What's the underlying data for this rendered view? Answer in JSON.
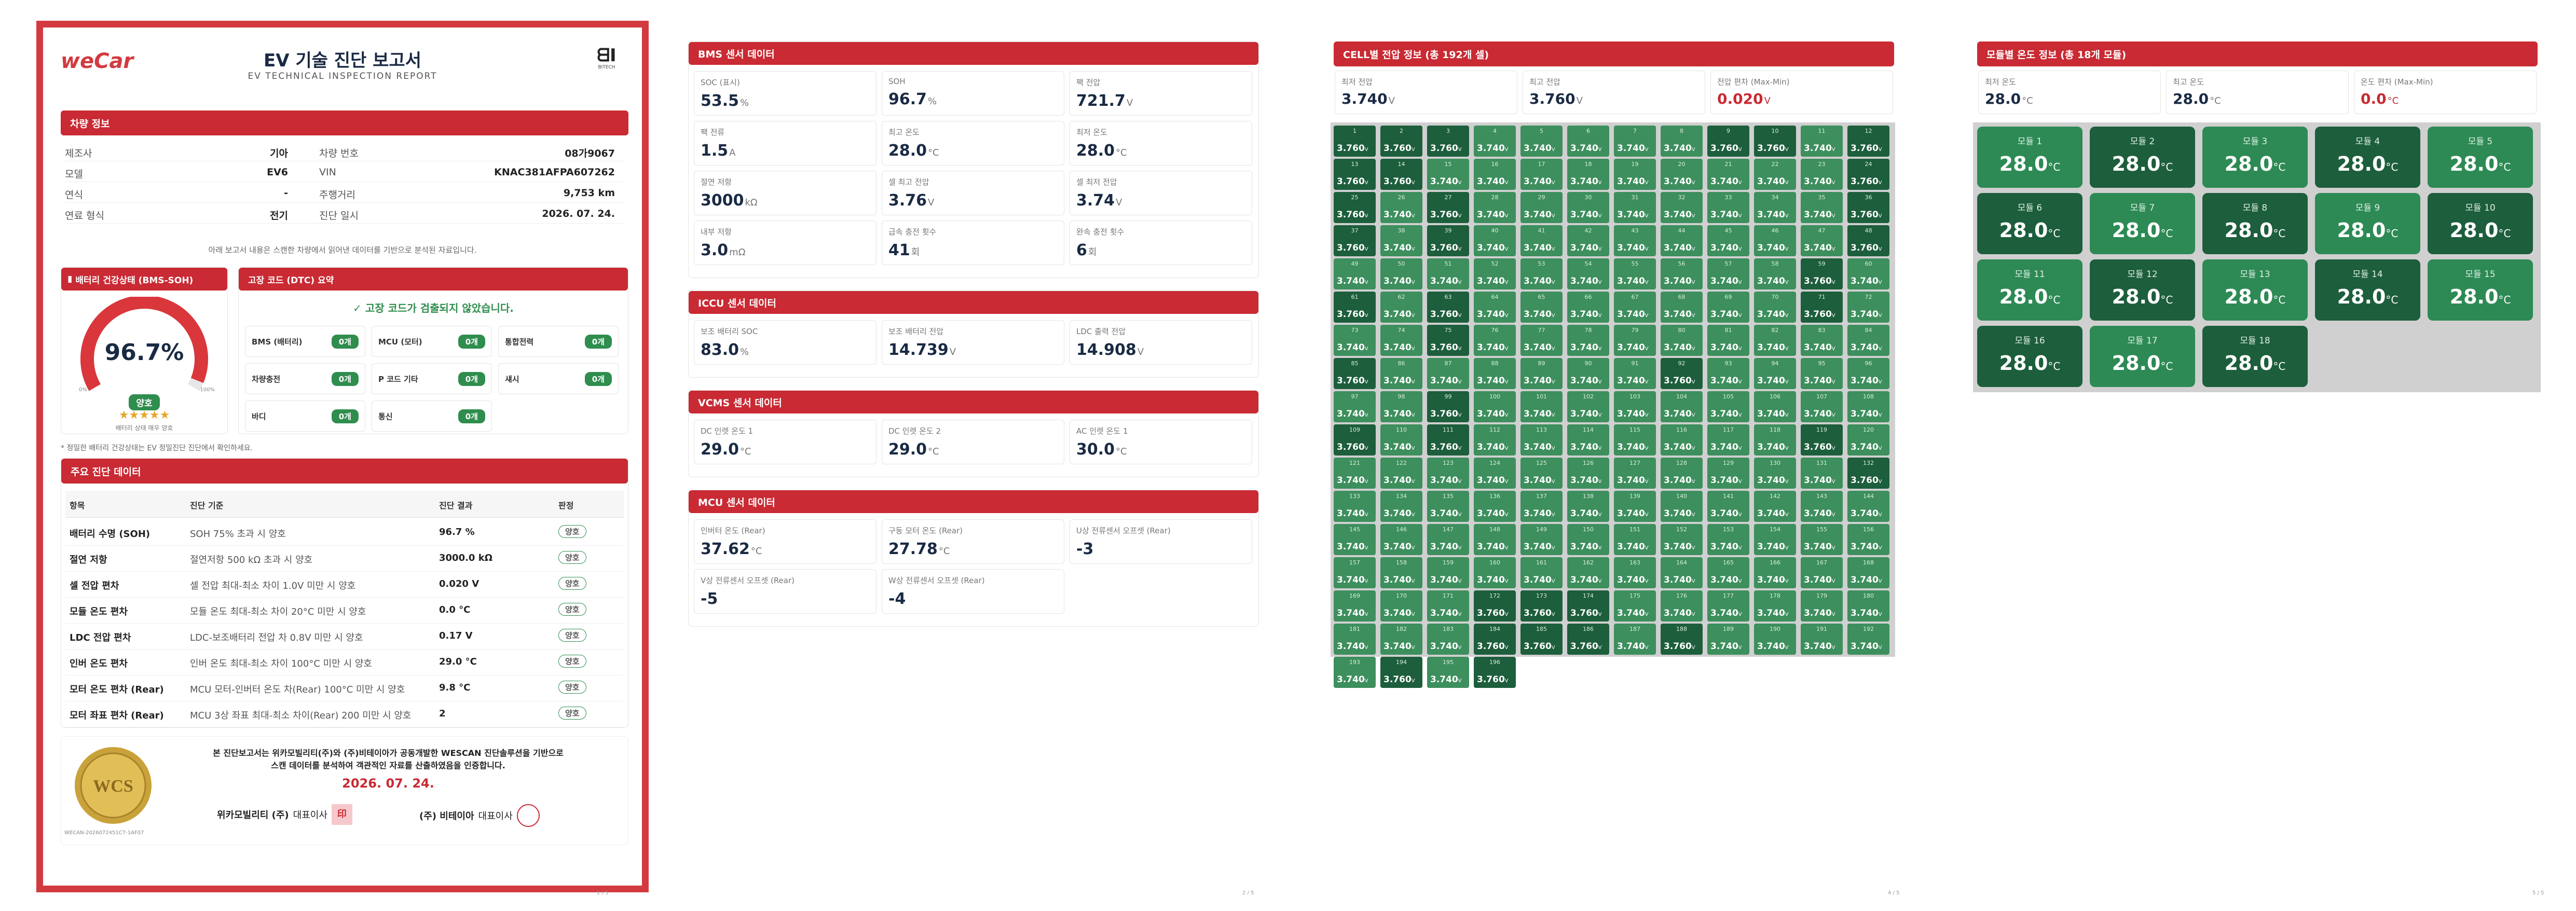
{
  "page1": {
    "logo": "weCar",
    "title": "EV 기술 진단 보고서",
    "subtitle": "EV TECHNICAL INSPECTION REPORT",
    "brand": "BITECH",
    "vehicle_header": "차량 정보",
    "vehicle": [
      [
        "제조사",
        "기아",
        "차량 번호",
        "08가9067"
      ],
      [
        "모델",
        "EV6",
        "VIN",
        "KNAC381AFPA607262"
      ],
      [
        "연식",
        "-",
        "주행거리",
        "9,753 km"
      ],
      [
        "연료 형식",
        "전기",
        "진단 일시",
        "2026. 07. 24."
      ]
    ],
    "note": "아래 보고서 내용은 스캔한 차량에서 읽어낸 데이터를 기반으로 분석된 자료입니다.",
    "soh_header": "배터리 건강상태 (BMS-SOH)",
    "soh_value": "96.7%",
    "soh_fraction": 0.967,
    "gauge_min": "0%",
    "gauge_max": "100%",
    "soh_badge": "양호",
    "stars": "★★★★★",
    "soh_caption": "배터리 상태 매우 양호",
    "dtc_header": "고장 코드 (DTC) 요약",
    "dtc_ok": "✓ 고장 코드가 검출되지 않았습니다.",
    "dtc": [
      [
        "BMS (배터리)",
        "0개"
      ],
      [
        "MCU (모터)",
        "0개"
      ],
      [
        "통합전력",
        "0개"
      ],
      [
        "차량충전",
        "0개"
      ],
      [
        "P 코드 기타",
        "0개"
      ],
      [
        "섀시",
        "0개"
      ],
      [
        "바디",
        "0개"
      ],
      [
        "통신",
        "0개"
      ]
    ],
    "footnote": "* 정밀한 배터리 건강상태는 EV 정밀진단 진단에서 확인하세요.",
    "main_header": "주요 진단 데이터",
    "cols": [
      "항목",
      "진단 기준",
      "진단 결과",
      "판정"
    ],
    "rows": [
      [
        "배터리 수명 (SOH)",
        "SOH 75% 초과 시 양호",
        "96.7 %",
        "양호"
      ],
      [
        "절연 저항",
        "절연저항 500 kΩ 초과 시 양호",
        "3000.0 kΩ",
        "양호"
      ],
      [
        "셀 전압 편차",
        "셀 전압 최대-최소 차이 1.0V 미만 시 양호",
        "0.020 V",
        "양호"
      ],
      [
        "모듈 온도 편차",
        "모듈 온도 최대-최소 차이 20°C 미만 시 양호",
        "0.0 °C",
        "양호"
      ],
      [
        "LDC 전압 편차",
        "LDC-보조배터리 전압 차 0.8V 미만 시 양호",
        "0.17 V",
        "양호"
      ],
      [
        "인버 온도 편차",
        "인버 온도 최대-최소 차이 100°C 미만 시 양호",
        "29.0 °C",
        "양호"
      ],
      [
        "모터 온도 편차 (Rear)",
        "MCU 모터-인버터 온도 차(Rear) 100°C 미만 시 양호",
        "9.8 °C",
        "양호"
      ],
      [
        "모터 좌표 편차 (Rear)",
        "MCU 3상 좌표 최대-최소 차이(Rear) 200 미만 시 양호",
        "2",
        "양호"
      ]
    ],
    "cert1": "본 진단보고서는 위카모빌리티(주)와 (주)비테이아가 공동개발한 WESCAN 진단솔루션을 기반으로",
    "cert2": "스캔 데이터를 분석하여 객관적인 자료를 산출하였음을 인증합니다.",
    "cert_date": "2026. 07. 24.",
    "seal_text": "WCS",
    "seal_id": "WECAN-2026072451C7-1AF07",
    "sign1_org": "위카모빌리티 (주)",
    "sign1_role": "대표이사",
    "sign1_stamp": "印",
    "sign2_org": "(주) 비테이아",
    "sign2_role": "대표이사",
    "page_no": "1 / 5"
  },
  "page2": {
    "page_no": "2 / 5",
    "sections": [
      {
        "title": "BMS 센서 데이터",
        "items": [
          [
            "SOC (표시)",
            "53.5",
            "%"
          ],
          [
            "SOH",
            "96.7",
            "%"
          ],
          [
            "팩 전압",
            "721.7",
            "V"
          ],
          [
            "팩 전류",
            "1.5",
            "A"
          ],
          [
            "최고 온도",
            "28.0",
            "°C"
          ],
          [
            "최저 온도",
            "28.0",
            "°C"
          ],
          [
            "절연 저항",
            "3000",
            "kΩ"
          ],
          [
            "셀 최고 전압",
            "3.76",
            "V"
          ],
          [
            "셀 최저 전압",
            "3.74",
            "V"
          ],
          [
            "내부 저항",
            "3.0",
            "mΩ"
          ],
          [
            "급속 충전 횟수",
            "41",
            "회"
          ],
          [
            "완속 충전 횟수",
            "6",
            "회"
          ]
        ]
      },
      {
        "title": "ICCU 센서 데이터",
        "items": [
          [
            "보조 배터리 SOC",
            "83.0",
            "%"
          ],
          [
            "보조 배터리 전압",
            "14.739",
            "V"
          ],
          [
            "LDC 출력 전압",
            "14.908",
            "V"
          ]
        ]
      },
      {
        "title": "VCMS 센서 데이터",
        "items": [
          [
            "DC 인렛 온도 1",
            "29.0",
            "°C"
          ],
          [
            "DC 인렛 온도 2",
            "29.0",
            "°C"
          ],
          [
            "AC 인렛 온도 1",
            "30.0",
            "°C"
          ]
        ]
      },
      {
        "title": "MCU 센서 데이터",
        "items": [
          [
            "인버터 온도 (Rear)",
            "37.62",
            "°C"
          ],
          [
            "구동 모터 온도 (Rear)",
            "27.78",
            "°C"
          ],
          [
            "U상 전류센서 오프셋 (Rear)",
            "-3",
            ""
          ],
          [
            "V상 전류센서 오프셋 (Rear)",
            "-5",
            ""
          ],
          [
            "W상 전류센서 오프셋 (Rear)",
            "-4",
            ""
          ]
        ]
      }
    ]
  },
  "page3": {
    "page_no": "4 / 5",
    "title": "CELL별 전압 정보 (총 192개 셀)",
    "stats": [
      [
        "최저 전압",
        "3.740",
        "V"
      ],
      [
        "최고 전압",
        "3.760",
        "V"
      ],
      [
        "전압 편차 (Max-Min)",
        "0.020",
        "V"
      ]
    ],
    "unit": "V",
    "cells": [
      "3.760",
      "3.760",
      "3.760",
      "3.740",
      "3.740",
      "3.740",
      "3.740",
      "3.740",
      "3.760",
      "3.760",
      "3.740",
      "3.760",
      "3.760",
      "3.760",
      "3.740",
      "3.740",
      "3.740",
      "3.740",
      "3.740",
      "3.740",
      "3.740",
      "3.740",
      "3.740",
      "3.760",
      "3.760",
      "3.740",
      "3.760",
      "3.740",
      "3.740",
      "3.740",
      "3.740",
      "3.740",
      "3.740",
      "3.740",
      "3.740",
      "3.760",
      "3.760",
      "3.740",
      "3.760",
      "3.740",
      "3.740",
      "3.740",
      "3.740",
      "3.740",
      "3.740",
      "3.740",
      "3.740",
      "3.760",
      "3.740",
      "3.740",
      "3.740",
      "3.740",
      "3.740",
      "3.740",
      "3.740",
      "3.740",
      "3.740",
      "3.740",
      "3.760",
      "3.740",
      "3.760",
      "3.740",
      "3.760",
      "3.740",
      "3.740",
      "3.740",
      "3.740",
      "3.740",
      "3.740",
      "3.740",
      "3.760",
      "3.740",
      "3.740",
      "3.740",
      "3.760",
      "3.740",
      "3.740",
      "3.740",
      "3.740",
      "3.740",
      "3.740",
      "3.740",
      "3.740",
      "3.740",
      "3.760",
      "3.740",
      "3.740",
      "3.740",
      "3.740",
      "3.740",
      "3.740",
      "3.760",
      "3.740",
      "3.740",
      "3.740",
      "3.740",
      "3.740",
      "3.740",
      "3.760",
      "3.740",
      "3.740",
      "3.740",
      "3.740",
      "3.740",
      "3.740",
      "3.740",
      "3.740",
      "3.740",
      "3.760",
      "3.740",
      "3.760",
      "3.740",
      "3.740",
      "3.740",
      "3.740",
      "3.740",
      "3.740",
      "3.740",
      "3.760",
      "3.740",
      "3.740",
      "3.740",
      "3.740",
      "3.740",
      "3.740",
      "3.740",
      "3.740",
      "3.740",
      "3.740",
      "3.740",
      "3.740",
      "3.760",
      "3.740",
      "3.740",
      "3.740",
      "3.740",
      "3.740",
      "3.740",
      "3.740",
      "3.740",
      "3.740",
      "3.740",
      "3.740",
      "3.740",
      "3.740",
      "3.740",
      "3.740",
      "3.740",
      "3.740",
      "3.740",
      "3.740",
      "3.740",
      "3.740",
      "3.740",
      "3.740",
      "3.740",
      "3.740",
      "3.740",
      "3.740",
      "3.740",
      "3.740",
      "3.740",
      "3.740",
      "3.740",
      "3.740",
      "3.740",
      "3.740",
      "3.740",
      "3.740",
      "3.740",
      "3.740",
      "3.760",
      "3.760",
      "3.760",
      "3.740",
      "3.740",
      "3.740",
      "3.740",
      "3.740",
      "3.740",
      "3.740",
      "3.740",
      "3.740",
      "3.760",
      "3.760",
      "3.760",
      "3.740",
      "3.760",
      "3.740",
      "3.740",
      "3.740",
      "3.740",
      "3.740",
      "3.760",
      "3.740",
      "3.760"
    ]
  },
  "page4": {
    "page_no": "5 / 5",
    "title": "모듈별 온도 정보 (총 18개 모듈)",
    "stats": [
      [
        "최저 온도",
        "28.0",
        "°C"
      ],
      [
        "최고 온도",
        "28.0",
        "°C"
      ],
      [
        "온도 편차 (Max-Min)",
        "0.0",
        "°C"
      ]
    ],
    "unit": "°C",
    "modules": [
      [
        "모듈 1",
        "28.0"
      ],
      [
        "모듈 2",
        "28.0"
      ],
      [
        "모듈 3",
        "28.0"
      ],
      [
        "모듈 4",
        "28.0"
      ],
      [
        "모듈 5",
        "28.0"
      ],
      [
        "모듈 6",
        "28.0"
      ],
      [
        "모듈 7",
        "28.0"
      ],
      [
        "모듈 8",
        "28.0"
      ],
      [
        "모듈 9",
        "28.0"
      ],
      [
        "모듈 10",
        "28.0"
      ],
      [
        "모듈 11",
        "28.0"
      ],
      [
        "모듈 12",
        "28.0"
      ],
      [
        "모듈 13",
        "28.0"
      ],
      [
        "모듈 14",
        "28.0"
      ],
      [
        "모듈 15",
        "28.0"
      ],
      [
        "모듈 16",
        "28.0"
      ],
      [
        "모듈 17",
        "28.0"
      ],
      [
        "모듈 18",
        "28.0"
      ]
    ]
  },
  "colors": {
    "accent": "#c92a33",
    "ok": "#2f8d4e",
    "cell": "#3d8f5d",
    "cell_dark": "#1d5e3c"
  }
}
